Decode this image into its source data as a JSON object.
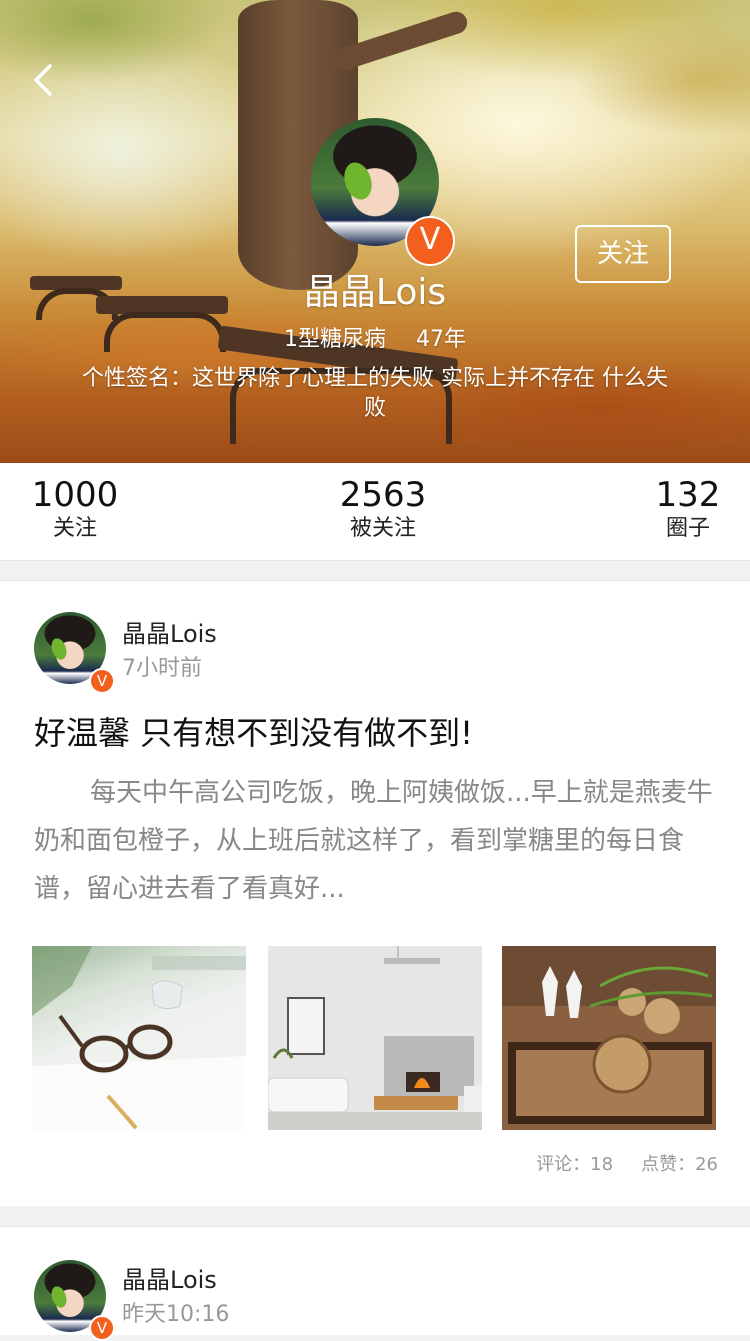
{
  "profile": {
    "nickname": "晶晶Lois",
    "diabetes_type": "1型糖尿病",
    "years": "47年",
    "signature": "个性签名：这世界除了心理上的失败 实际上并不存在 什么失败",
    "follow_label": "关注",
    "badge": "V"
  },
  "stats": [
    {
      "num": "1000",
      "label": "关注"
    },
    {
      "num": "2563",
      "label": "被关注"
    },
    {
      "num": "132",
      "label": "圈子"
    }
  ],
  "posts": [
    {
      "author": "晶晶Lois",
      "time": "7小时前",
      "title": "好温馨 只有想不到没有做不到!",
      "body": "每天中午高公司吃饭，晚上阿姨做饭...早上就是燕麦牛奶和面包橙子，从上班后就这样了，看到掌糖里的每日食谱，留心进去看了看真好...",
      "comments": "评论：18",
      "likes": "点赞：26"
    },
    {
      "author": "晶晶Lois",
      "time": "昨天10:16"
    }
  ],
  "colors": {
    "accent": "#f3601d",
    "background": "#f2f2f2"
  }
}
